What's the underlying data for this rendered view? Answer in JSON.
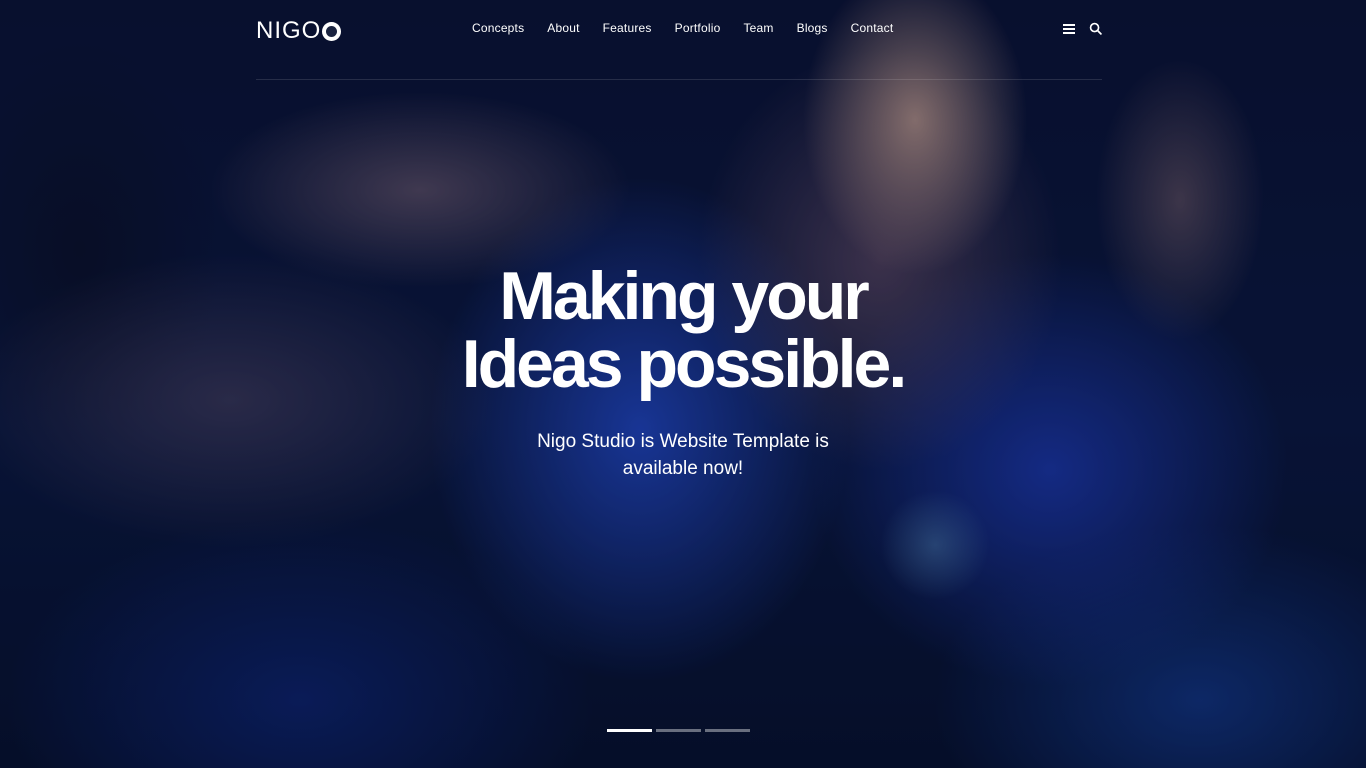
{
  "brand": {
    "logo_text": "NIGO"
  },
  "nav": {
    "items": [
      {
        "label": "Concepts"
      },
      {
        "label": "About"
      },
      {
        "label": "Features"
      },
      {
        "label": "Portfolio"
      },
      {
        "label": "Team"
      },
      {
        "label": "Blogs"
      },
      {
        "label": "Contact"
      }
    ]
  },
  "header_icons": [
    "menu-icon",
    "search-icon"
  ],
  "hero": {
    "headline_line1": "Making your",
    "headline_line2": "Ideas possible.",
    "subheading": "Nigo Studio is Website Template is available now!"
  },
  "slider": {
    "slide_count": 3,
    "active_slide": 1
  },
  "colors": {
    "text": "#ffffff",
    "background": "#070b1f"
  }
}
